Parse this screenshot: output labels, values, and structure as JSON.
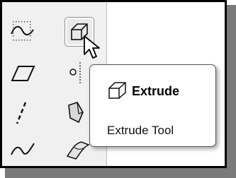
{
  "toolbar": {
    "buttons": [
      {
        "icon": "sketched-curve-icon"
      },
      {
        "icon": "extrude-icon",
        "state": "active"
      },
      {
        "icon": "parallelogram-icon"
      },
      {
        "icon": "reference-point-icon"
      },
      {
        "icon": "dashed-line-icon"
      },
      {
        "icon": "shaded-solid-icon"
      },
      {
        "icon": "spline-icon"
      },
      {
        "icon": "surface-icon"
      }
    ]
  },
  "tooltip": {
    "title": "Extrude",
    "description": "Extrude Tool",
    "icon": "extrude-icon"
  }
}
